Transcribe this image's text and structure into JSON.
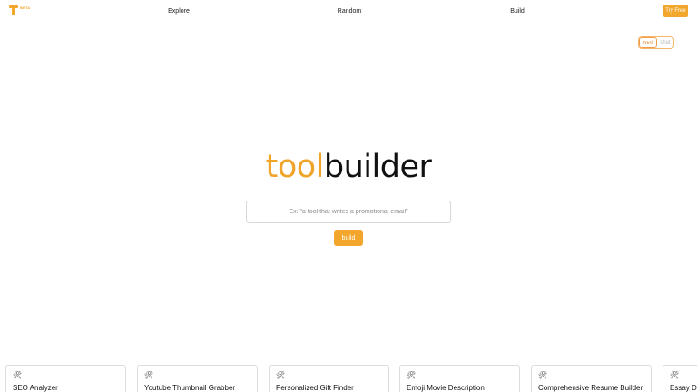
{
  "nav": {
    "logo_badge": "BETA",
    "links": [
      "Explore",
      "Random",
      "Build"
    ],
    "cta_label": "Try Free",
    "accent_color": "#f2a62b"
  },
  "mode_toggle": {
    "options": [
      "tool",
      "chat"
    ],
    "selected": "tool"
  },
  "hero": {
    "title_part1": "tool",
    "title_part2": "builder"
  },
  "prompt": {
    "placeholder": "Ex: \"a tool that writes a promotional email\"",
    "value": "",
    "build_label": "build"
  },
  "cards": [
    {
      "icon": "tools-icon",
      "title": "SEO Analyzer"
    },
    {
      "icon": "tools-icon",
      "title": "Youtube Thumbnail Grabber"
    },
    {
      "icon": "tools-icon",
      "title": "Personalized Gift Finder"
    },
    {
      "icon": "tools-icon",
      "title": "Emoji Movie Description"
    },
    {
      "icon": "tools-icon",
      "title": "Comprehensive Resume Builder"
    },
    {
      "icon": "tools-icon",
      "title": "Essay Dra"
    }
  ]
}
